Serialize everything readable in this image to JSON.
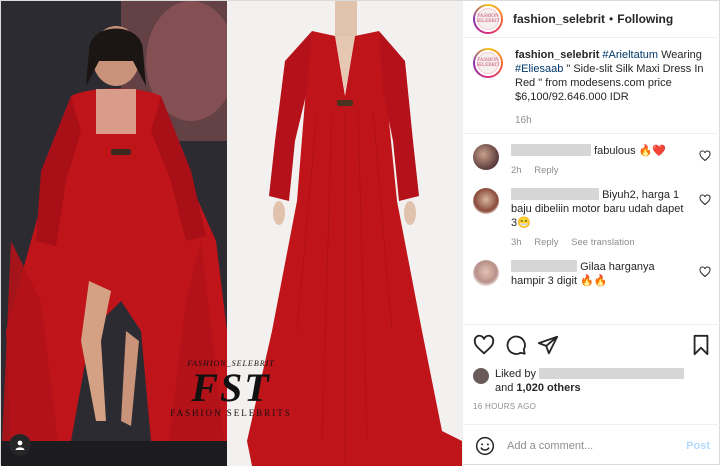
{
  "watermark": {
    "top": "FASHION_SELEBRIT",
    "big": "FST",
    "bottom": "FASHION SELEBRITS"
  },
  "header": {
    "avatar_text": "FASHION SELEBRIT",
    "username": "fashion_selebrit",
    "separator": "•",
    "follow_label": "Following"
  },
  "caption": {
    "username": "fashion_selebrit",
    "hashtag1": "#Arieltatum",
    "text1": " Wearing ",
    "hashtag2": "#Eliesaab",
    "text2": " \" Side-slit Silk Maxi Dress In Red \" from modesens.com price $6,100/92.646.000 IDR",
    "time": "16h"
  },
  "comments": [
    {
      "text": "fabulous 🔥❤️",
      "time": "2h",
      "reply": "Reply",
      "see_translation": ""
    },
    {
      "text": "Biyuh2, harga 1 baju dibeliin motor baru udah dapet 3😁",
      "time": "3h",
      "reply": "Reply",
      "see_translation": "See translation"
    },
    {
      "text": "Gilaa harganya hampir 3 digit 🔥🔥",
      "time": "",
      "reply": "",
      "see_translation": ""
    }
  ],
  "likes": {
    "prefix": "Liked by",
    "suffix_pre": "and ",
    "others": "1,020 others"
  },
  "posted_ago": "16 HOURS AGO",
  "add_comment": {
    "placeholder": "Add a comment...",
    "post_label": "Post"
  },
  "colors": {
    "dress_red": "#c0141b",
    "link_blue": "#00376b",
    "post_disabled": "#b3dbff"
  }
}
